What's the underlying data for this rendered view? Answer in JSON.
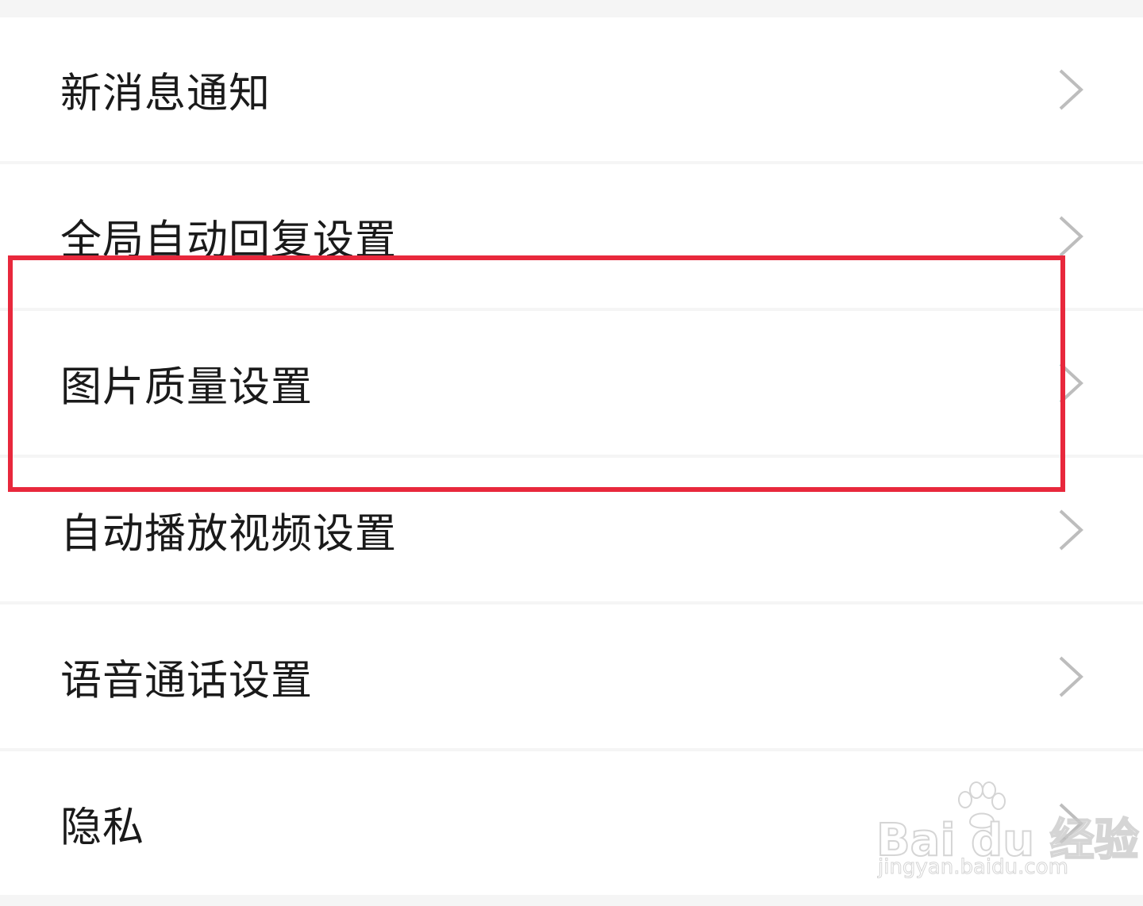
{
  "settings": {
    "items": [
      {
        "label": "新消息通知"
      },
      {
        "label": "全局自动回复设置"
      },
      {
        "label": "图片质量设置"
      },
      {
        "label": "自动播放视频设置"
      },
      {
        "label": "语音通话设置"
      },
      {
        "label": "隐私"
      }
    ]
  },
  "icons": {
    "row_trailing": "chevron-right-icon"
  },
  "annotation": {
    "color": "#e8283c",
    "highlighted_item": "图片质量设置"
  },
  "watermark": {
    "brand": "Bai du 经验",
    "url": "jingyan.baidu.com"
  }
}
